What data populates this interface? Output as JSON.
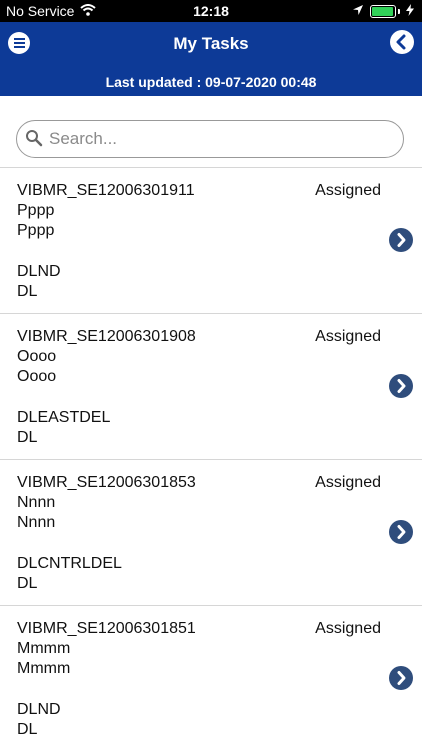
{
  "status_bar": {
    "carrier": "No Service",
    "time": "12:18",
    "battery_level": 0.95
  },
  "header": {
    "title": "My Tasks",
    "last_updated": "Last updated : 09-07-2020 00:48"
  },
  "search": {
    "placeholder": "Search..."
  },
  "tasks": [
    {
      "id": "VIBMR_SE12006301911",
      "line1": "Pppp",
      "line2": "Pppp",
      "line3": "DLND",
      "line4": "DL",
      "status": "Assigned"
    },
    {
      "id": "VIBMR_SE12006301908",
      "line1": "Oooo",
      "line2": "Oooo",
      "line3": "DLEASTDEL",
      "line4": "DL",
      "status": "Assigned"
    },
    {
      "id": "VIBMR_SE12006301853",
      "line1": "Nnnn",
      "line2": "Nnnn",
      "line3": "DLCNTRLDEL",
      "line4": "DL",
      "status": "Assigned"
    },
    {
      "id": "VIBMR_SE12006301851",
      "line1": "Mmmm",
      "line2": "Mmmm",
      "line3": "DLND",
      "line4": "DL",
      "status": "Assigned"
    }
  ],
  "colors": {
    "header_bg": "#0d3a97",
    "chevron_bg": "#2f4d7c"
  }
}
